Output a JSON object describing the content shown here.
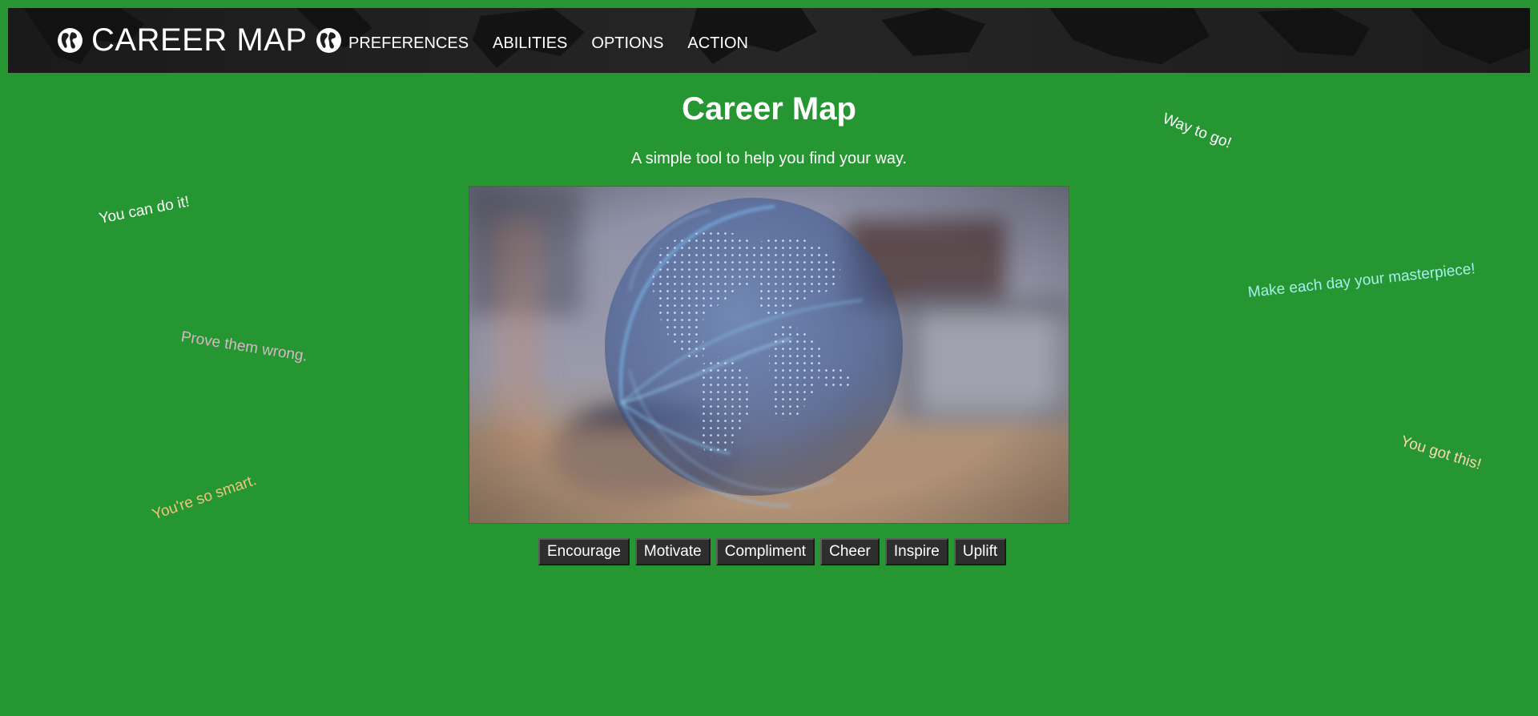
{
  "header": {
    "brand": "CAREER MAP",
    "nav": [
      {
        "label": "PREFERENCES"
      },
      {
        "label": "ABILITIES"
      },
      {
        "label": "OPTIONS"
      },
      {
        "label": "ACTION"
      }
    ]
  },
  "main": {
    "title": "Career Map",
    "subtitle": "A simple tool to help you find your way.",
    "buttons": [
      {
        "label": "Encourage"
      },
      {
        "label": "Motivate"
      },
      {
        "label": "Compliment"
      },
      {
        "label": "Cheer"
      },
      {
        "label": "Inspire"
      },
      {
        "label": "Uplift"
      }
    ]
  },
  "messages": [
    {
      "text": "You can do it!",
      "color": "#ffffff"
    },
    {
      "text": "Prove them wrong.",
      "color": "#d9b7c9"
    },
    {
      "text": "You're so smart.",
      "color": "#f2c37f"
    },
    {
      "text": "Way to go!",
      "color": "#ffffff"
    },
    {
      "text": "Make each day your masterpiece!",
      "color": "#a8f0ec"
    },
    {
      "text": "You got this!",
      "color": "#f8d8b4"
    }
  ],
  "colors": {
    "background": "#259631",
    "navbar": "#1d1d1d",
    "button": "#2e2e2e"
  },
  "icons": {
    "brand_left": "globe-icon",
    "brand_right": "globe-icon"
  }
}
